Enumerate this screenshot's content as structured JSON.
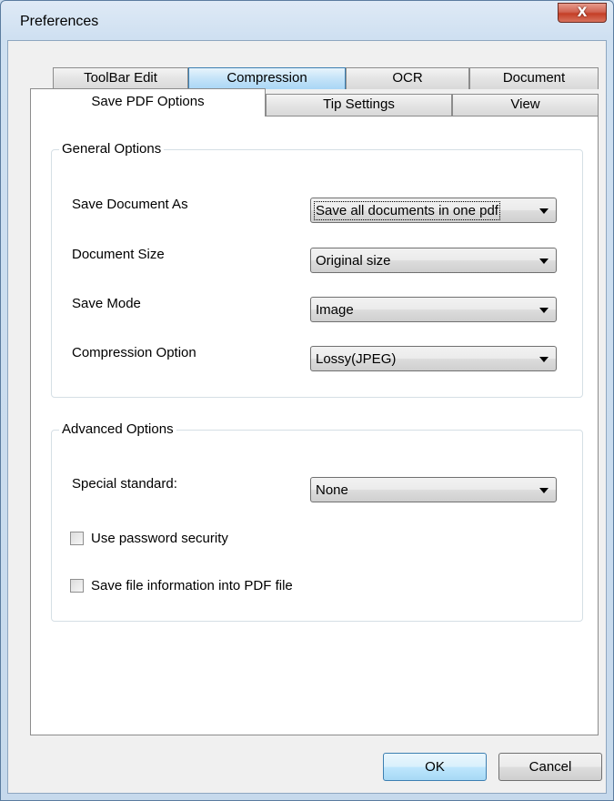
{
  "window": {
    "title": "Preferences",
    "close_glyph": "X"
  },
  "tabs_top_row": [
    {
      "label": "ToolBar Edit"
    },
    {
      "label": "Compression"
    },
    {
      "label": "OCR"
    },
    {
      "label": "Document"
    }
  ],
  "tabs_bottom_row": [
    {
      "label": "Save PDF Options",
      "active": true
    },
    {
      "label": "Tip Settings"
    },
    {
      "label": "View"
    }
  ],
  "general_options": {
    "title": "General Options",
    "rows": [
      {
        "label": "Save Document As",
        "value": "Save all documents in one pdf"
      },
      {
        "label": "Document Size",
        "value": "Original size"
      },
      {
        "label": "Save Mode",
        "value": "Image"
      },
      {
        "label": "Compression Option",
        "value": "Lossy(JPEG)"
      }
    ]
  },
  "advanced_options": {
    "title": "Advanced Options",
    "special_standard": {
      "label": "Special standard:",
      "value": "None"
    },
    "checkboxes": [
      {
        "label": "Use password security",
        "checked": false
      },
      {
        "label": "Save file information into PDF file",
        "checked": false
      }
    ]
  },
  "buttons": {
    "ok": "OK",
    "cancel": "Cancel"
  }
}
